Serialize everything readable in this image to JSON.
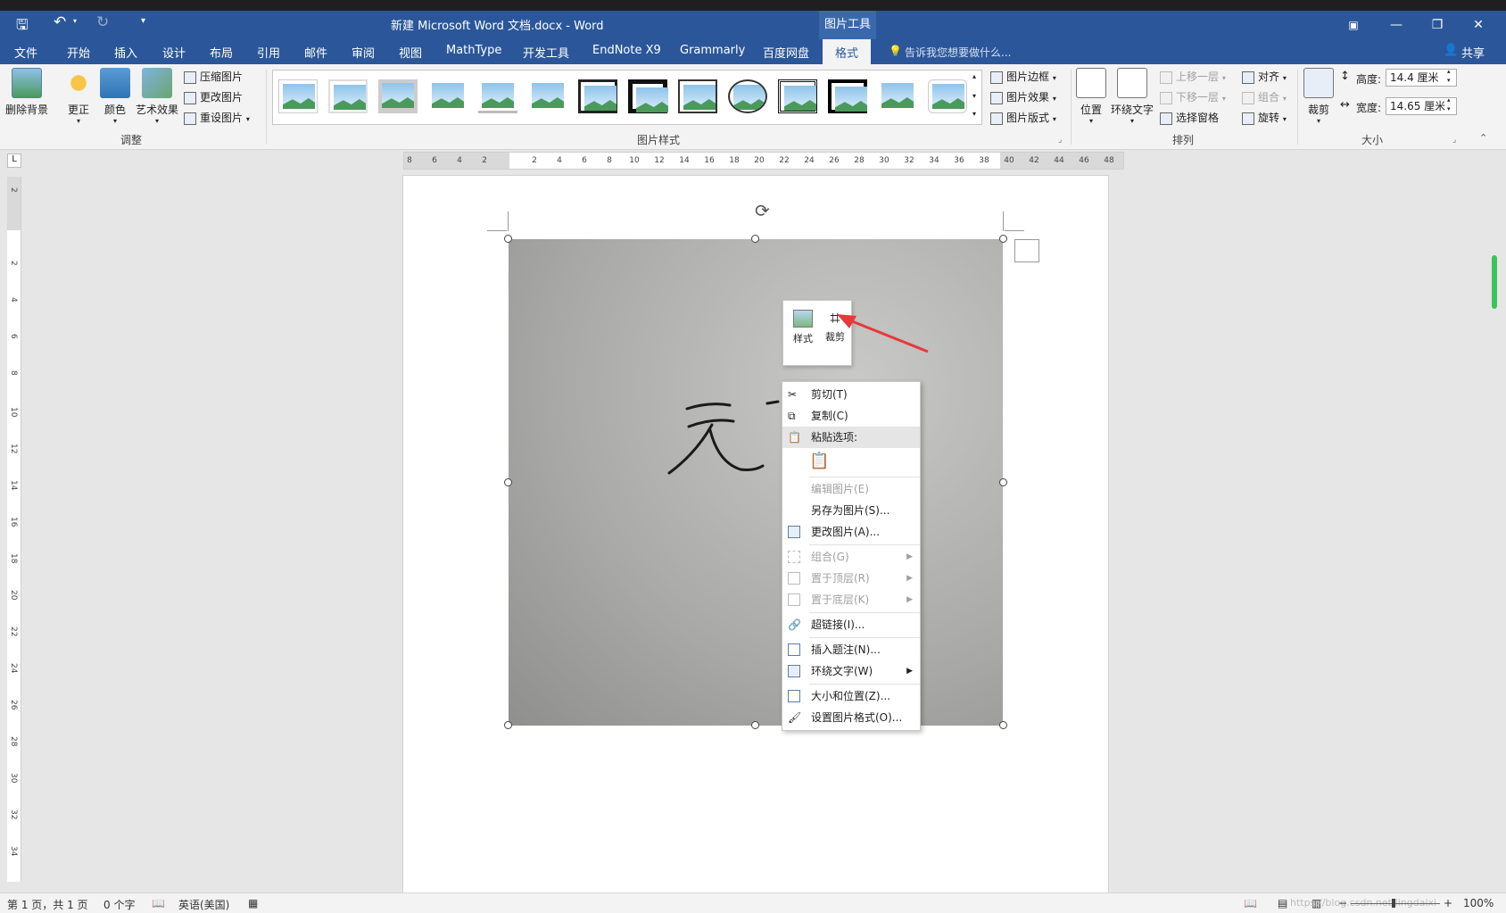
{
  "titlebar": {
    "title": "新建 Microsoft Word 文档.docx - Word",
    "context_tool": "图片工具",
    "qat": {
      "save": "save-icon",
      "undo": "undo-icon",
      "redo": "redo-icon",
      "customize": "customize-qat-icon"
    },
    "window_buttons": {
      "ribbon_options": "▣",
      "minimize": "—",
      "restore": "❐",
      "close": "✕"
    }
  },
  "tabs": [
    "文件",
    "开始",
    "插入",
    "设计",
    "布局",
    "引用",
    "邮件",
    "审阅",
    "视图",
    "MathType",
    "开发工具",
    "EndNote X9",
    "Grammarly",
    "百度网盘",
    "格式"
  ],
  "active_tab": "格式",
  "tell_me": "告诉我您想要做什么...",
  "share": "共享",
  "ribbon": {
    "adjust": {
      "label": "调整",
      "remove_bg": "删除背景",
      "corrections": "更正",
      "color": "颜色",
      "artistic": "艺术效果",
      "compress": "压缩图片",
      "change": "更改图片",
      "reset": "重设图片"
    },
    "styles": {
      "label": "图片样式",
      "border": "图片边框",
      "effects": "图片效果",
      "layout": "图片版式"
    },
    "arrange": {
      "label": "排列",
      "position": "位置",
      "wrap": "环绕文字",
      "forward": "上移一层",
      "backward": "下移一层",
      "selection": "选择窗格",
      "align": "对齐",
      "group": "组合",
      "rotate": "旋转"
    },
    "size": {
      "label": "大小",
      "crop": "裁剪",
      "height_label": "高度:",
      "height_value": "14.4 厘米",
      "width_label": "宽度:",
      "width_value": "14.65 厘米"
    }
  },
  "hruler_ticks": [
    "8",
    "6",
    "4",
    "2",
    "",
    "2",
    "4",
    "6",
    "8",
    "10",
    "12",
    "14",
    "16",
    "18",
    "20",
    "22",
    "24",
    "26",
    "28",
    "30",
    "32",
    "34",
    "36",
    "38",
    "40",
    "42",
    "44",
    "46",
    "48"
  ],
  "vruler_ticks": [
    "2",
    "",
    "2",
    "4",
    "6",
    "8",
    "10",
    "12",
    "14",
    "16",
    "18",
    "20",
    "22",
    "24",
    "26",
    "28",
    "30",
    "32",
    "34"
  ],
  "minibar": {
    "style": "样式",
    "crop": "裁剪"
  },
  "context_menu": {
    "cut": "剪切(T)",
    "copy": "复制(C)",
    "paste_options": "粘贴选项:",
    "edit_picture": "编辑图片(E)",
    "save_as_picture": "另存为图片(S)...",
    "change_picture": "更改图片(A)...",
    "group": "组合(G)",
    "bring_front": "置于顶层(R)",
    "send_back": "置于底层(K)",
    "hyperlink": "超链接(I)...",
    "insert_caption": "插入题注(N)...",
    "wrap_text": "环绕文字(W)",
    "size_position": "大小和位置(Z)...",
    "format_picture": "设置图片格式(O)..."
  },
  "statusbar": {
    "page": "第 1 页，共 1 页",
    "words": "0 个字",
    "language": "英语(美国)",
    "zoom": "100%",
    "watermark": "https://blog.csdn.net/lingdaixi"
  },
  "colors": {
    "brand": "#2b579a",
    "ribbon": "#f3f3f3",
    "arrow": "#e8383a"
  }
}
